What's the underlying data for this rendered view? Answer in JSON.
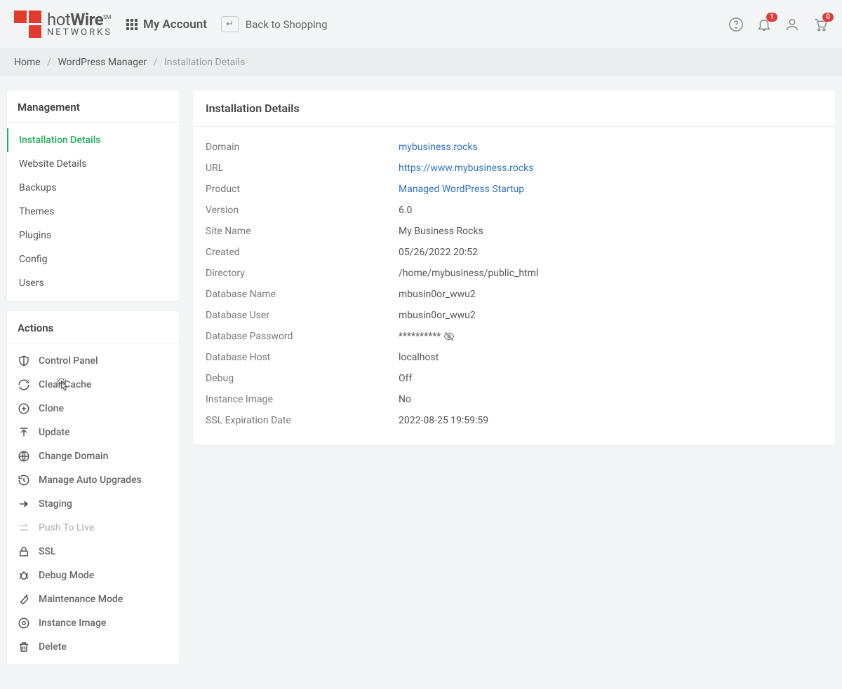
{
  "header": {
    "brand_top": "hotWire",
    "brand_sub": "NETWORKS",
    "my_account": "My Account",
    "back_key": "↵",
    "back_label": "Back to Shopping",
    "bell_badge": "1",
    "cart_badge": "0"
  },
  "breadcrumb": {
    "home": "Home",
    "wp_manager": "WordPress Manager",
    "current": "Installation Details"
  },
  "management": {
    "title": "Management",
    "items": [
      {
        "label": "Installation Details",
        "active": true
      },
      {
        "label": "Website Details"
      },
      {
        "label": "Backups"
      },
      {
        "label": "Themes"
      },
      {
        "label": "Plugins"
      },
      {
        "label": "Config"
      },
      {
        "label": "Users"
      }
    ]
  },
  "actions": {
    "title": "Actions",
    "items": {
      "control_panel": "Control Panel",
      "clear_cache": "Clear Cache",
      "clone": "Clone",
      "update": "Update",
      "change_domain": "Change Domain",
      "manage_auto": "Manage Auto Upgrades",
      "staging": "Staging",
      "push_live": "Push To Live",
      "ssl": "SSL",
      "debug_mode": "Debug Mode",
      "maintenance": "Maintenance Mode",
      "instance_image": "Instance Image",
      "delete": "Delete"
    }
  },
  "panel": {
    "title": "Installation Details",
    "rows": {
      "domain": {
        "label": "Domain",
        "value": "mybusiness.rocks"
      },
      "url": {
        "label": "URL",
        "value": "https://www.mybusiness.rocks"
      },
      "product": {
        "label": "Product",
        "value": "Managed WordPress Startup"
      },
      "version": {
        "label": "Version",
        "value": "6.0"
      },
      "site_name": {
        "label": "Site Name",
        "value": "My Business Rocks"
      },
      "created": {
        "label": "Created",
        "value": "05/26/2022 20:52"
      },
      "directory": {
        "label": "Directory",
        "value": "/home/mybusiness/public_html"
      },
      "db_name": {
        "label": "Database Name",
        "value": "mbusin0or_wwu2"
      },
      "db_user": {
        "label": "Database User",
        "value": "mbusin0or_wwu2"
      },
      "db_pass": {
        "label": "Database Password",
        "value": "**********"
      },
      "db_host": {
        "label": "Database Host",
        "value": "localhost"
      },
      "debug": {
        "label": "Debug",
        "value": "Off"
      },
      "inst_image": {
        "label": "Instance Image",
        "value": "No"
      },
      "ssl_exp": {
        "label": "SSL Expiration Date",
        "value": "2022-08-25 19:59:59"
      }
    }
  }
}
